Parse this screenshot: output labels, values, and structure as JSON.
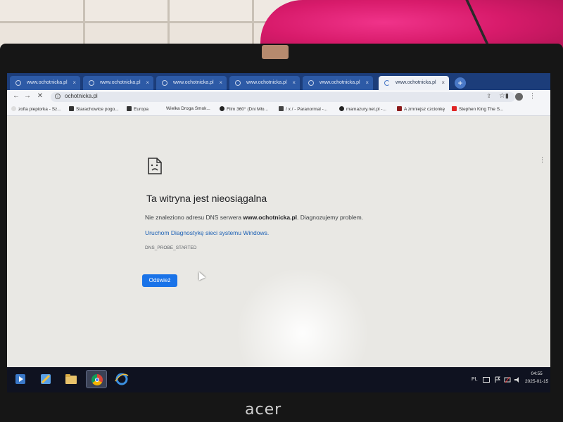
{
  "browser": {
    "tabs": [
      {
        "title": "www.ochotnicka.pl",
        "active": false
      },
      {
        "title": "www.ochotnicka.pl",
        "active": false
      },
      {
        "title": "www.ochotnicka.pl",
        "active": false
      },
      {
        "title": "www.ochotnicka.pl",
        "active": false
      },
      {
        "title": "www.ochotnicka.pl",
        "active": false
      },
      {
        "title": "www.ochotnicka.pl",
        "active": true
      }
    ],
    "tab_close": "×",
    "new_tab": "+",
    "address": "ochotnicka.pl",
    "bookmarks": [
      {
        "label": "zofia piepiorka - Sz..."
      },
      {
        "label": "Starachowice pogo..."
      },
      {
        "label": "Europa"
      },
      {
        "label": "Wielka Droga Smok..."
      },
      {
        "label": "Film 360° (Dni Mło..."
      },
      {
        "label": "/ x / - Paranormal -..."
      },
      {
        "label": "mamazury.net.pl -..."
      },
      {
        "label": "A zmniejsz czcionkę"
      },
      {
        "label": "Stephen King The S..."
      }
    ],
    "icons": {
      "back": "←",
      "forward": "→",
      "stop": "✕",
      "info": "i",
      "share": "⇪",
      "star": "☆",
      "sidebar": "▮",
      "menu": "⋮"
    }
  },
  "error_page": {
    "title": "Ta witryna jest nieosiągalna",
    "message_before": "Nie znaleziono adresu DNS serwera ",
    "domain": "www.ochotnicka.pl",
    "message_after": ". Diagnozujemy problem.",
    "link": "Uruchom Diagnostykę sieci systemu Windows.",
    "error_code": "DNS_PROBE_STARTED",
    "reload_button": "Odśwież"
  },
  "taskbar": {
    "language": "PL",
    "time": "04:55",
    "date": "2025-01-15"
  },
  "device": {
    "brand": "acer"
  },
  "colors": {
    "link": "#1a5fb4",
    "button": "#1a73e8",
    "tabbar": "#1c3d7a"
  }
}
